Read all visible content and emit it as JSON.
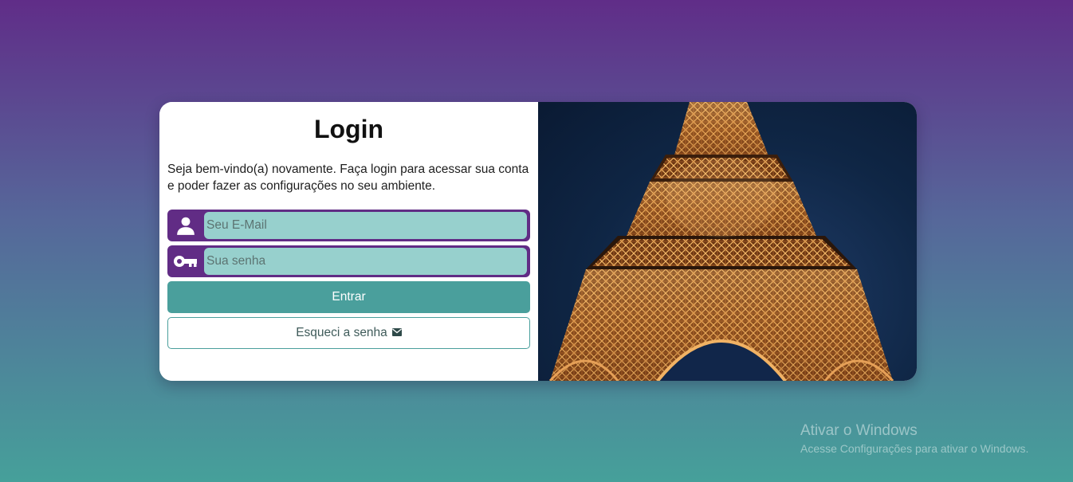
{
  "login": {
    "title": "Login",
    "welcome_text": "Seja bem-vindo(a) novamente. Faça login para acessar sua conta e poder fazer as configurações no seu ambiente.",
    "email_placeholder": "Seu E-Mail",
    "email_icon": "user-icon",
    "password_placeholder": "Sua senha",
    "password_icon": "key-icon",
    "submit_label": "Entrar",
    "forgot_label": "Esqueci a senha",
    "forgot_icon": "envelope-icon"
  },
  "hero_image": {
    "subject": "eiffel-tower-night-photo"
  },
  "windows_watermark": {
    "title": "Ativar o Windows",
    "subtitle": "Acesse Configurações para ativar o Windows."
  },
  "colors": {
    "background_top": "#602d88",
    "background_bottom": "#46a09a",
    "input_group": "#612c85",
    "input_fill": "#97d0cd",
    "primary_button": "#4a9f9c"
  }
}
